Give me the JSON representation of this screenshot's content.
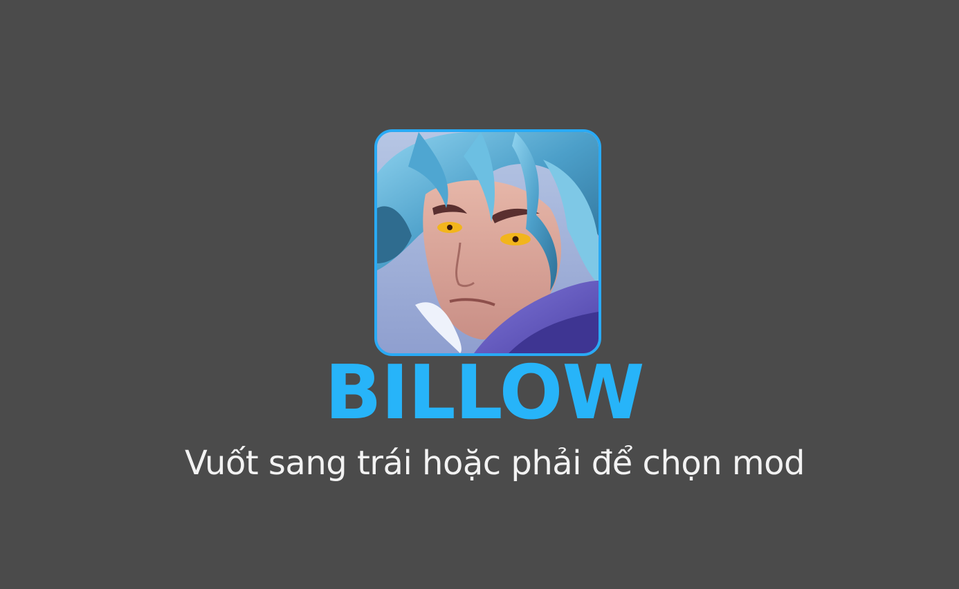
{
  "hero": {
    "name": "BILLOW",
    "portrait_icon": "hero-portrait-icon"
  },
  "hint": {
    "text": "Vuốt sang trái hoặc phải để chọn mod"
  },
  "colors": {
    "background": "#4b4b4b",
    "accent": "#27b4f9",
    "frame_border": "#29aaf5",
    "hint_text": "#f2f2f2"
  }
}
